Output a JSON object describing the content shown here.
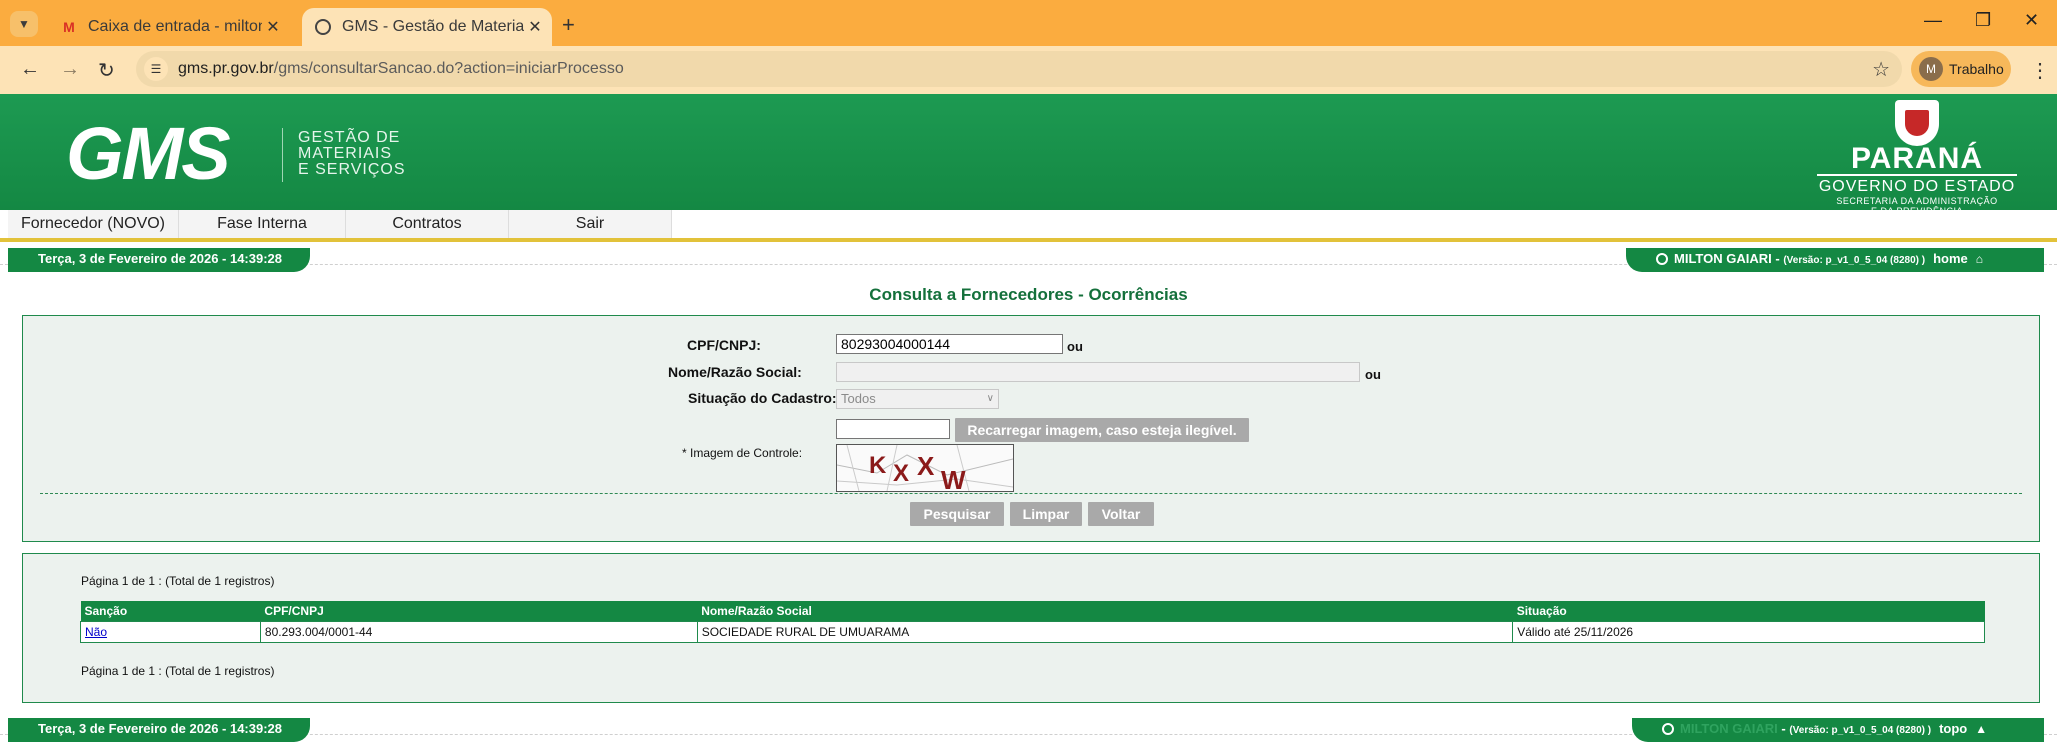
{
  "browser": {
    "tabs": [
      {
        "title": "Caixa de entrada - miltongaiari",
        "icon": "gmail-icon",
        "active": false
      },
      {
        "title": "GMS - Gestão de Materiais e Se",
        "icon": "globe-icon",
        "active": true
      }
    ],
    "url_host": "gms.pr.gov.br",
    "url_path": "/gms/consultarSancao.do?action=iniciarProcesso",
    "profile_initial": "M",
    "profile_name": "Trabalho"
  },
  "header": {
    "logo_text": "GMS",
    "logo_sub": [
      "GESTÃO DE",
      "MATERIAIS",
      "E SERVIÇOS"
    ],
    "state_name": "PARANÁ",
    "state_gov": "GOVERNO DO ESTADO",
    "state_sec": [
      "SECRETARIA DA ADMINISTRAÇÃO",
      "E DA PREVIDÊNCIA"
    ]
  },
  "menu": [
    "Fornecedor (NOVO)",
    "Fase Interna",
    "Contratos",
    "Sair"
  ],
  "status": {
    "date": "Terça, 3 de Fevereiro de 2026 - 14:39:28",
    "user": "MILTON GAIARI",
    "version": "(Versão: p_v1_0_5_04 (8280) )",
    "home_link": "home",
    "top_link": "topo"
  },
  "page_title": "Consulta a Fornecedores - Ocorrências",
  "form": {
    "cpf_label": "CPF/CNPJ:",
    "cpf_value": "80293004000144",
    "ou": "ou",
    "nome_label": "Nome/Razão Social:",
    "nome_value": "",
    "situacao_label": "Situação do Cadastro:",
    "situacao_value": "Todos",
    "captcha_value": "",
    "reload_button": "Recarregar imagem, caso esteja ilegível.",
    "control_label": "* Imagem de Controle:",
    "captcha_chars": [
      "K",
      "X",
      "X",
      "W"
    ],
    "search_button": "Pesquisar",
    "clear_button": "Limpar",
    "back_button": "Voltar"
  },
  "results": {
    "pager_text": "Página 1 de 1 : (Total de 1 registros)",
    "columns": [
      "Sanção",
      "CPF/CNPJ",
      "Nome/Razão Social",
      "Situação"
    ],
    "rows": [
      {
        "sancao": "Não",
        "cnpj": "80.293.004/0001-44",
        "nome": "SOCIEDADE RURAL DE UMUARAMA",
        "situacao": "Válido até 25/11/2026"
      }
    ]
  },
  "colors": {
    "brand_green": "#148843",
    "chrome_orange": "#fbac3f",
    "captcha_red": "#8b1a1a"
  }
}
